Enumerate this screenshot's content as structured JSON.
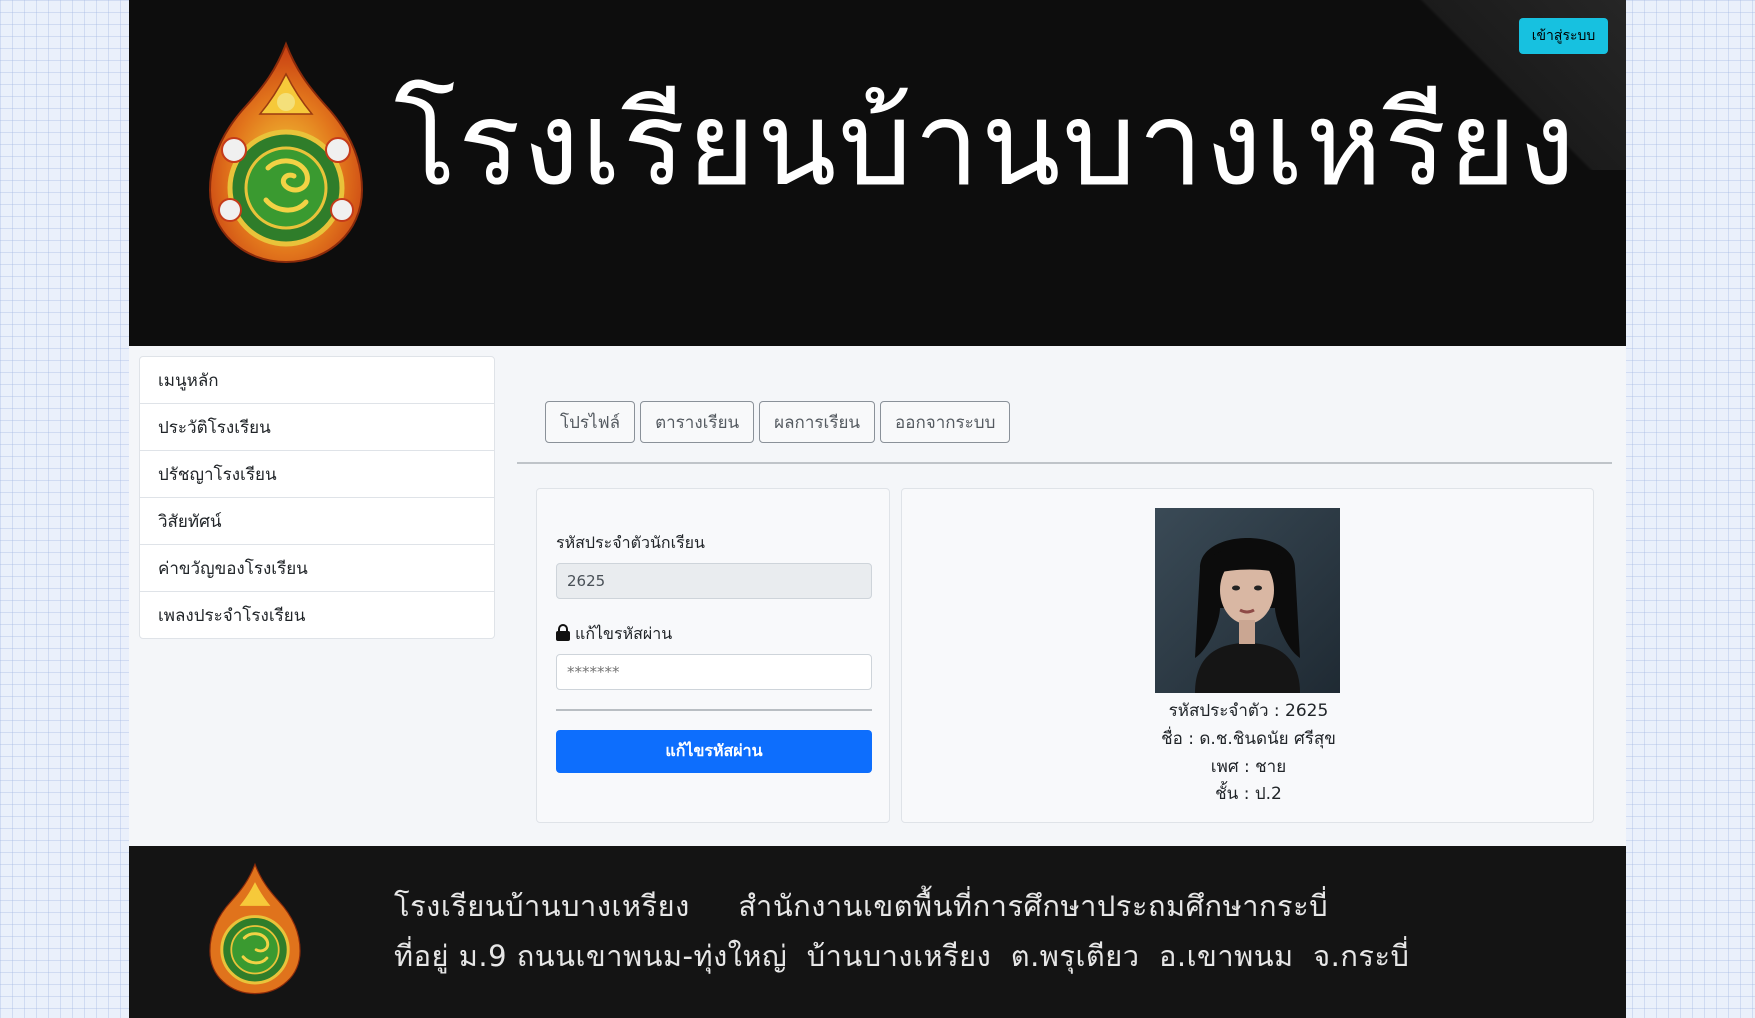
{
  "header": {
    "school_name": "โรงเรียนบ้านบางเหรียง",
    "login_label": "เข้าสู่ระบบ"
  },
  "sidebar": {
    "items": [
      {
        "label": "เมนูหลัก"
      },
      {
        "label": "ประวัติโรงเรียน"
      },
      {
        "label": "ปรัชญาโรงเรียน"
      },
      {
        "label": "วิสัยทัศน์"
      },
      {
        "label": "ค่าขวัญของโรงเรียน"
      },
      {
        "label": "เพลงประจำโรงเรียน"
      }
    ]
  },
  "tabs": [
    {
      "label": "โปรไฟล์"
    },
    {
      "label": "ตารางเรียน"
    },
    {
      "label": "ผลการเรียน"
    },
    {
      "label": "ออกจากระบบ"
    }
  ],
  "form": {
    "student_id_label": "รหัสประจำตัวนักเรียน",
    "student_id_value": "2625",
    "password_label": "แก้ไขรหัสผ่าน",
    "password_placeholder": "*******",
    "submit_label": "แก้ไขรหัสผ่าน"
  },
  "profile": {
    "id_line": "รหัสประจำตัว : 2625",
    "name_line": "ชื่อ : ด.ช.ชินดนัย ศรีสุข",
    "gender_line": "เพศ : ชาย",
    "class_line": "ชั้น : ป.2"
  },
  "footer": {
    "line1": "โรงเรียนบ้านบางเหรียง     สำนักงานเขตพื้นที่การศึกษาประถมศึกษากระบี่",
    "line2": "ที่อยู่ ม.9 ถนนเขาพนม-ทุ่งใหญ่  บ้านบางเหรียง  ต.พรุเตียว  อ.เขาพนม  จ.กระบี่"
  },
  "colors": {
    "accent_cyan": "#17c1e0",
    "primary_blue": "#0d6efd",
    "banner_bg": "#0d0d0d"
  },
  "icons": {
    "lock": "lock-icon",
    "seal": "school-seal-icon"
  }
}
